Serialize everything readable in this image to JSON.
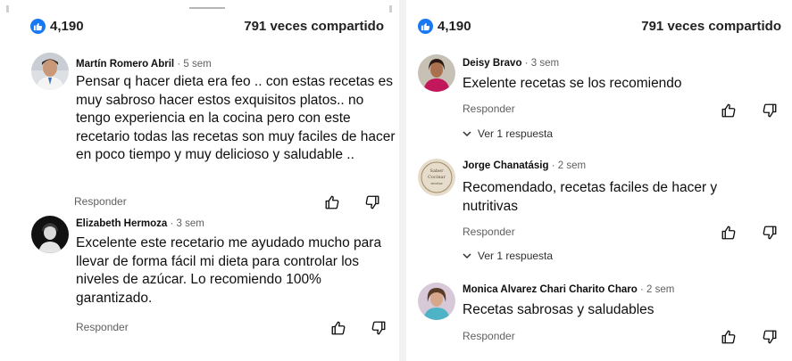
{
  "left": {
    "likes": "4,190",
    "shares": "791 veces compartido",
    "comments": [
      {
        "author": "Martín Romero Abril",
        "time": "5 sem",
        "text": "Pensar q hacer dieta era feo .. con estas recetas es muy sabroso hacer estos exquisitos platos.. no tengo experiencia en la cocina pero con este recetario todas las recetas son muy faciles de hacer en poco tiempo y muy delicioso y saludable ..",
        "reply": "Responder"
      },
      {
        "author": "Elizabeth Hermoza",
        "time": "3 sem",
        "text": "Excelente este recetario me ayudado mucho para llevar de forma fácil mi dieta para controlar los niveles de azúcar. Lo recomiendo 100% garantizado.",
        "reply": "Responder"
      }
    ]
  },
  "right": {
    "likes": "4,190",
    "shares": "791 veces compartido",
    "comments": [
      {
        "author": "Deisy Bravo",
        "time": "3 sem",
        "text": "Exelente recetas se los recomiendo",
        "reply": "Responder",
        "view_replies": "Ver 1 respuesta"
      },
      {
        "author": "Jorge Chanatásig",
        "time": "2 sem",
        "text": "Recomendado, recetas faciles de hacer y nutritivas",
        "reply": "Responder",
        "view_replies": "Ver 1 respuesta"
      },
      {
        "author": "Monica Alvarez Chari Charito Charo",
        "time": "2 sem",
        "text": "Recetas sabrosas y saludables",
        "reply": "Responder"
      }
    ]
  },
  "separator": "·",
  "colors": {
    "like_blue": "#1877f2",
    "muted": "#606060",
    "text": "#0f0f0f"
  }
}
